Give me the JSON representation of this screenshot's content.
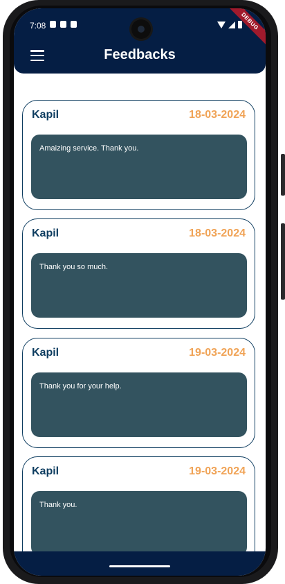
{
  "status_bar": {
    "time": "7:08",
    "debug_banner": "DEBUG"
  },
  "app_bar": {
    "title": "Feedbacks",
    "menu_icon": "hamburger-menu-icon"
  },
  "feedbacks": [
    {
      "name": "Kapil",
      "date": "18-03-2024",
      "message": "Amaizing service. Thank you."
    },
    {
      "name": "Kapil",
      "date": "18-03-2024",
      "message": "Thank you so much."
    },
    {
      "name": "Kapil",
      "date": "19-03-2024",
      "message": "Thank you for your help."
    },
    {
      "name": "Kapil",
      "date": "19-03-2024",
      "message": "Thank you."
    }
  ],
  "colors": {
    "primary": "#051e44",
    "card_border": "#0e3d60",
    "name": "#0e3d60",
    "date": "#f0a356",
    "message_bg": "#33535f",
    "debug": "#a01a2c"
  }
}
